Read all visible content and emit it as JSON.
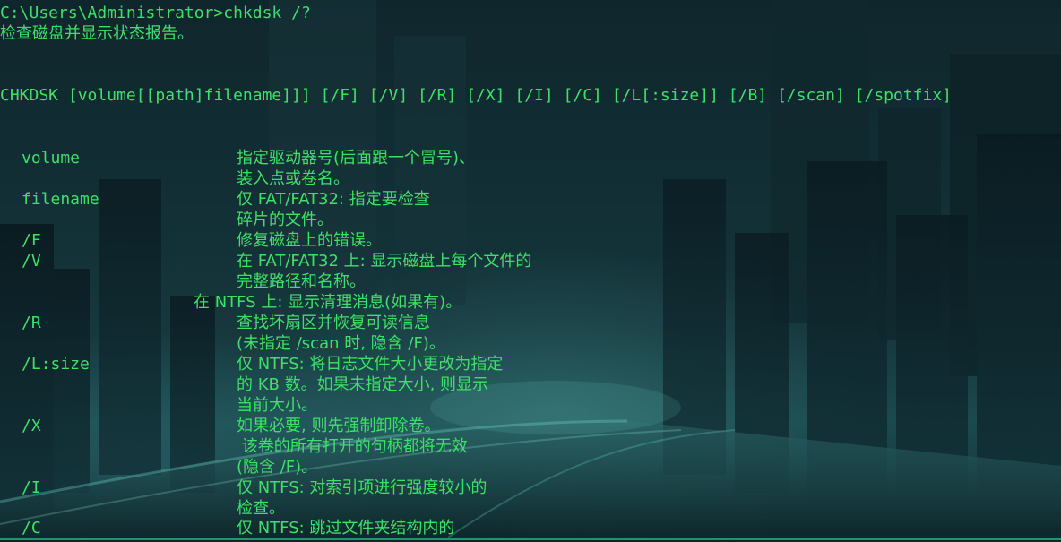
{
  "window": {
    "prompt": "C:\\Users\\Administrator>",
    "command": "chkdsk /?",
    "description": "检查磁盘并显示状态报告。",
    "syntax": "CHKDSK [volume[[path]filename]]] [/F] [/V] [/R] [/X] [/I] [/C] [/L[:size]] [/B] [/scan] [/spotfix]"
  },
  "options": [
    {
      "flag": "volume",
      "lines": [
        "指定驱动器号(后面跟一个冒号)、",
        "装入点或卷名。"
      ]
    },
    {
      "flag": "filename",
      "lines": [
        "仅 FAT/FAT32: 指定要检查",
        "碎片的文件。"
      ]
    },
    {
      "flag": "/F",
      "lines": [
        "修复磁盘上的错误。"
      ]
    },
    {
      "flag": "/V",
      "lines": [
        "在 FAT/FAT32 上: 显示磁盘上每个文件的",
        "完整路径和名称。",
        "在 NTFS 上: 显示清理消息(如果有)。"
      ]
    },
    {
      "flag": "/R",
      "lines": [
        "查找坏扇区并恢复可读信息",
        "(未指定 /scan 时, 隐含 /F)。"
      ]
    },
    {
      "flag": "/L:size",
      "lines": [
        "仅 NTFS: 将日志文件大小更改为指定",
        "的 KB 数。如果未指定大小, 则显示",
        "当前大小。"
      ]
    },
    {
      "flag": "/X",
      "lines": [
        "如果必要, 则先强制卸除卷。",
        " 该卷的所有打开的句柄都将无效",
        "(隐含 /F)。"
      ]
    },
    {
      "flag": "/I",
      "lines": [
        "仅 NTFS: 对索引项进行强度较小的",
        "检查。"
      ]
    },
    {
      "flag": "/C",
      "lines": [
        "仅 NTFS: 跳过文件夹结构内的"
      ]
    }
  ],
  "colors": {
    "text": "#3fe06a",
    "background": "#0b1c22"
  }
}
